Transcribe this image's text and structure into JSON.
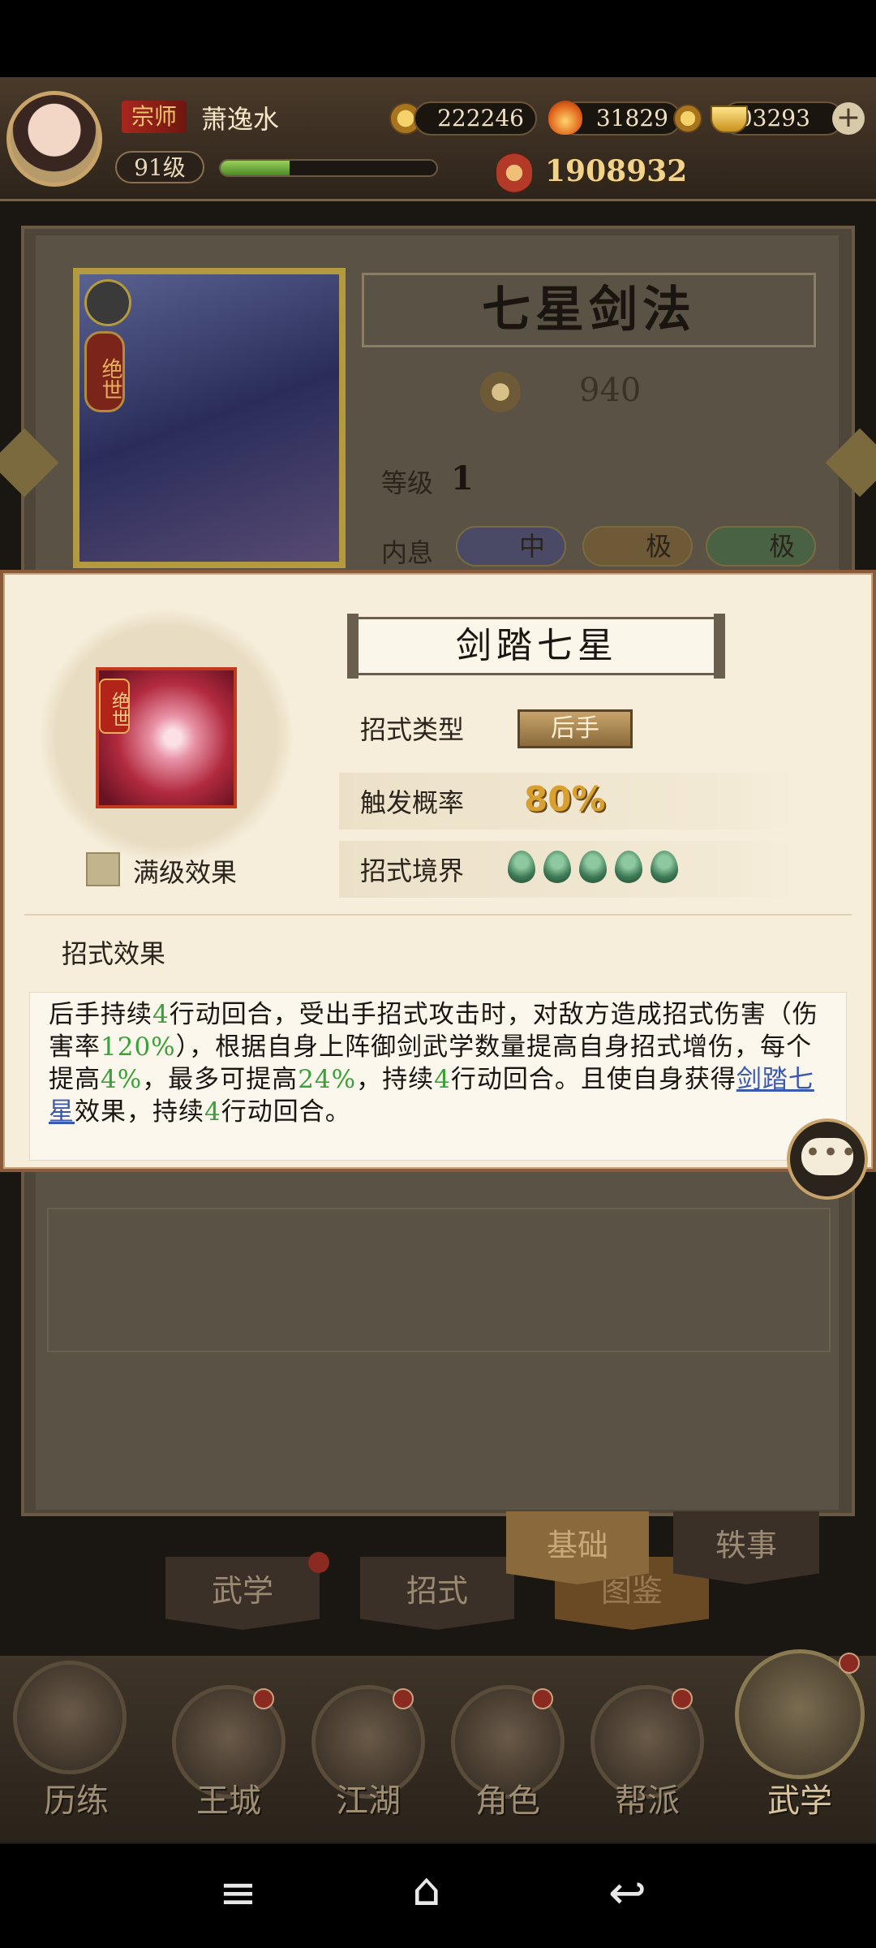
{
  "header": {
    "rank_title": "宗师",
    "player_name": "萧逸水",
    "level": "91级",
    "exp_fraction": 0.32,
    "coins": "222246",
    "flames": "31829",
    "ingots": "103293",
    "combat_power": "1908932"
  },
  "background": {
    "card_rank": "绝世",
    "skill_name": "七星剑法",
    "skill_power": "940",
    "level_label": "等级",
    "level_value": "1",
    "neixi_label": "内息",
    "neixi": [
      "中",
      "极",
      "极"
    ],
    "tabs": [
      "武学",
      "招式",
      "基础",
      "图鉴",
      "轶事"
    ]
  },
  "modal": {
    "move_name": "剑踏七星",
    "icon_tag": "绝世",
    "max_level_label": "满级效果",
    "move_type_label": "招式类型",
    "move_type_value": "后手",
    "trigger_label": "触发概率",
    "trigger_value": "80%",
    "realm_label": "招式境界",
    "realm_count": 5,
    "effects_title": "招式效果",
    "description": {
      "p1": "后手持续",
      "n1": "4",
      "p2": "行动回合，受出手招式攻击时，对敌方造成招式伤害（伤害率",
      "n2": "120%",
      "p3": "），根据自身上阵御剑武学数量提高自身招式增伤，每个提高",
      "n3": "4%",
      "p4": "，最多可提高",
      "n4": "24%",
      "p5": "，持续",
      "n5": "4",
      "p6": "行动回合。且使自身获得",
      "link": "剑踏七星",
      "p7": "效果，持续",
      "n6": "4",
      "p8": "行动回合。"
    }
  },
  "nav": [
    "历练",
    "王城",
    "江湖",
    "角色",
    "帮派",
    "武学"
  ],
  "colors": {
    "accent_gold": "#c9a46a",
    "highlight_green": "#3aa03a",
    "link_blue": "#3a5ab0",
    "trigger_orange": "#d8a030"
  }
}
